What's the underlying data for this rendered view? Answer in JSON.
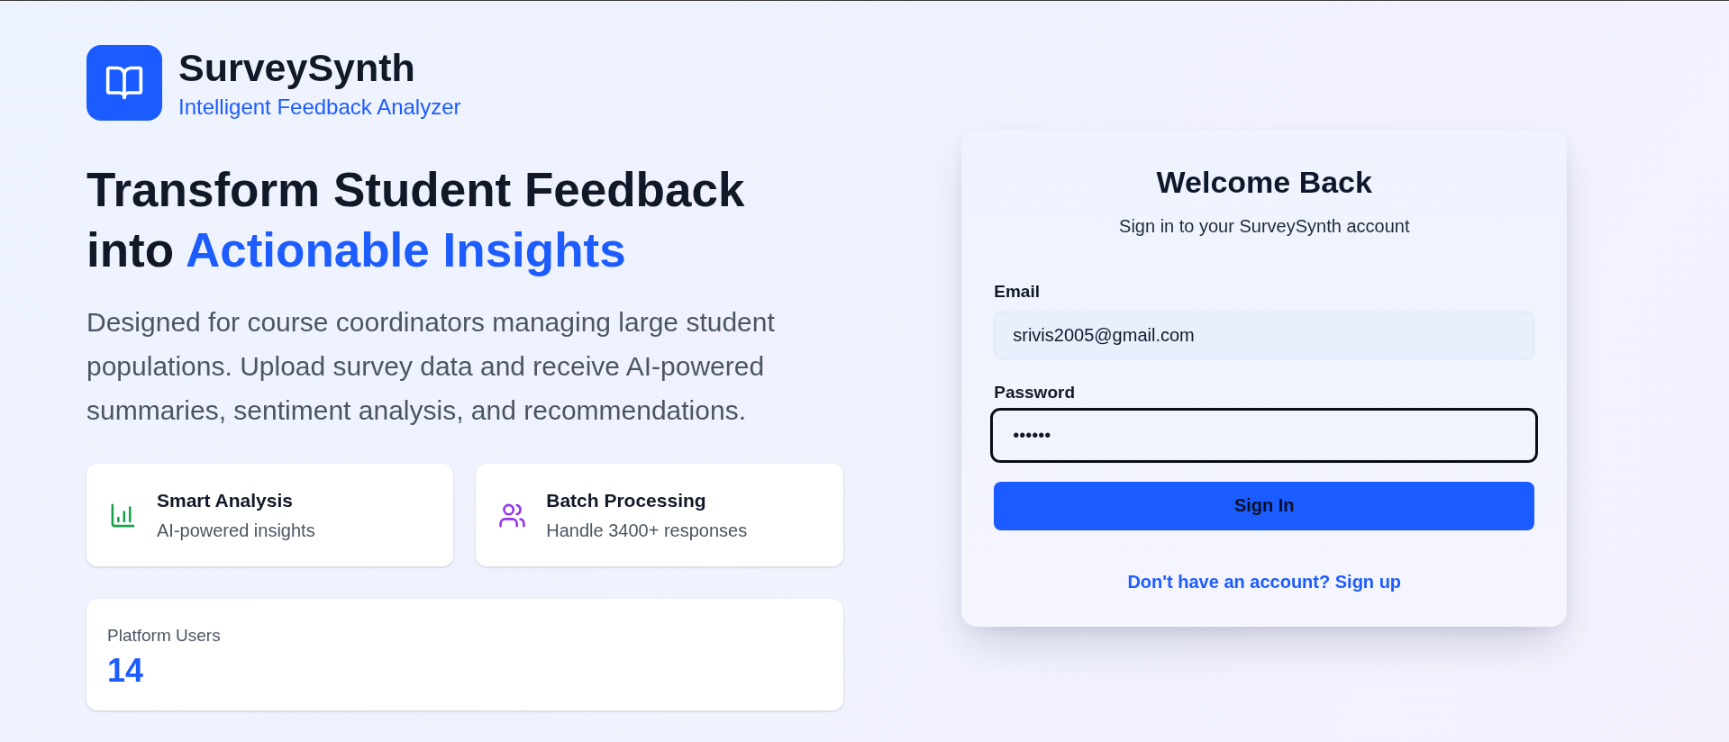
{
  "brand": {
    "name": "SurveySynth",
    "tagline": "Intelligent Feedback Analyzer"
  },
  "hero": {
    "headline": "Transform Student Feedback into",
    "highlight": "Actionable Insights",
    "description": "Designed for course coordinators managing large student populations. Upload survey data and receive AI-powered summaries, sentiment analysis, and recommendations."
  },
  "features": [
    {
      "kind": "chart",
      "title": "Smart Analysis",
      "subtitle": "AI-powered insights",
      "color": "#16a34a"
    },
    {
      "kind": "users",
      "title": "Batch Processing",
      "subtitle": "Handle 3400+ responses",
      "color": "#9333ea"
    }
  ],
  "stats": {
    "label": "Platform Users",
    "value": "14"
  },
  "login": {
    "title": "Welcome Back",
    "subtitle": "Sign in to your SurveySynth account",
    "fields": [
      {
        "label": "Email",
        "value": "srivis2005@gmail.com",
        "focused": false
      },
      {
        "label": "Password",
        "value": "••••••",
        "focused": true
      }
    ],
    "submit": "Sign In",
    "footer_link": "Don't have an account? Sign up"
  }
}
